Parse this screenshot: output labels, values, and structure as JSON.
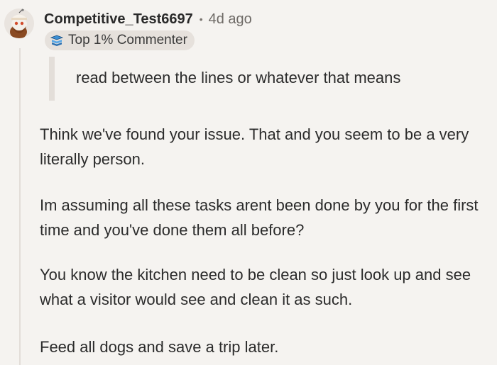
{
  "comment": {
    "author": "Competitive_Test6697",
    "separator": "•",
    "timestamp": "4d ago",
    "flair": "Top 1% Commenter",
    "flair_icon": "top-commenter-badge-icon",
    "avatar_icon": "snoo-avatar-icon",
    "quote": "read between the lines or whatever that means",
    "paragraphs": [
      "Think we've found your issue. That and you seem to be a very literally person.",
      "Im assuming all these tasks arent been done by you for the first time and you've done them all before?",
      "You know the kitchen need to be clean so just look up and see what a visitor would see and clean it as such.",
      "Feed all dogs and save a trip later."
    ]
  },
  "colors": {
    "background": "#f5f3f0",
    "text": "#2b2b2b",
    "meta_text": "#6e6a66",
    "flair_background": "#e6e1dc",
    "quote_bar": "#e3ded9",
    "thread_line": "#e2ddd8",
    "flair_icon_accent": "#3b8fd4"
  }
}
